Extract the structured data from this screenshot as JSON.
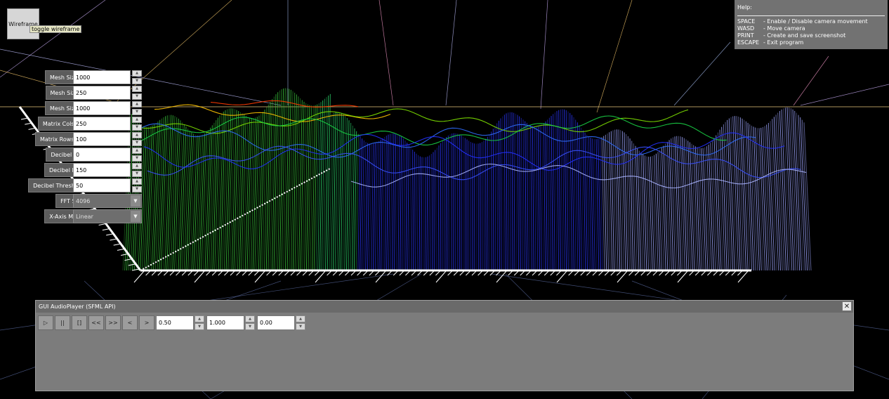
{
  "wireframe": {
    "label": "Wireframe",
    "tooltip": "toggle wireframe"
  },
  "help": {
    "title": "Help:",
    "rows": [
      {
        "key": "SPACE",
        "desc": "- Enable / Disable camera movement"
      },
      {
        "key": "WASD",
        "desc": "- Move camera"
      },
      {
        "key": "PRINT",
        "desc": "- Create and save screenshot"
      },
      {
        "key": "ESCAPE",
        "desc": "- Exit program"
      }
    ]
  },
  "settings": {
    "mesh_size_x": {
      "label": "Mesh Size X",
      "value": "1000"
    },
    "mesh_size_y": {
      "label": "Mesh Size Y",
      "value": "250"
    },
    "mesh_size_z": {
      "label": "Mesh Size Z",
      "value": "1000"
    },
    "matrix_cols": {
      "label": "Matrix Cols [x]",
      "value": "250"
    },
    "matrix_rows": {
      "label": "Matrix Rows [y]",
      "value": "100"
    },
    "decibel_min": {
      "label": "Decibel Min",
      "value": "0"
    },
    "decibel_max": {
      "label": "Decibel Max",
      "value": "150"
    },
    "decibel_threshold": {
      "label": "Decibel Threshold",
      "value": "50"
    },
    "fft_size": {
      "label": "FFT Size",
      "value": "4096"
    },
    "x_axis_mode": {
      "label": "X-Axis Mode",
      "value": "Linear"
    }
  },
  "player": {
    "title": "GUI AudioPlayer (SFML API)",
    "close_label": "✕",
    "controls": {
      "play": "▷",
      "pause": "||",
      "stop": "[]",
      "rewind": "<<",
      "fast_forward": ">>",
      "prev": "<",
      "next": ">"
    },
    "volume": "0.50",
    "pitch": "1.000",
    "position": "0.00"
  },
  "colors": {
    "background": "#000000",
    "panel": "#7c7c7c",
    "low": "#2020ff",
    "mid": "#00cc44",
    "high": "#ff2000"
  }
}
